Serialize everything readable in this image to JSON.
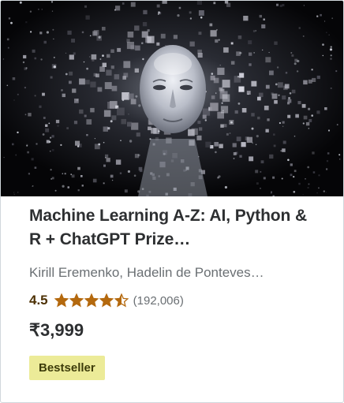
{
  "course": {
    "thumbnail_icon": "ai-face-image",
    "title": "Machine Learning A-Z: AI, Python & R + ChatGPT Prize…",
    "instructors": "Kirill Eremenko, Hadelin de Ponteves…",
    "rating": "4.5",
    "rating_fraction": 0.9,
    "rating_count": "(192,006)",
    "price": "₹3,999",
    "badge": "Bestseller"
  },
  "colors": {
    "star": "#b4690e",
    "badge_bg": "#eceb98",
    "rating_text": "#4d3105"
  }
}
